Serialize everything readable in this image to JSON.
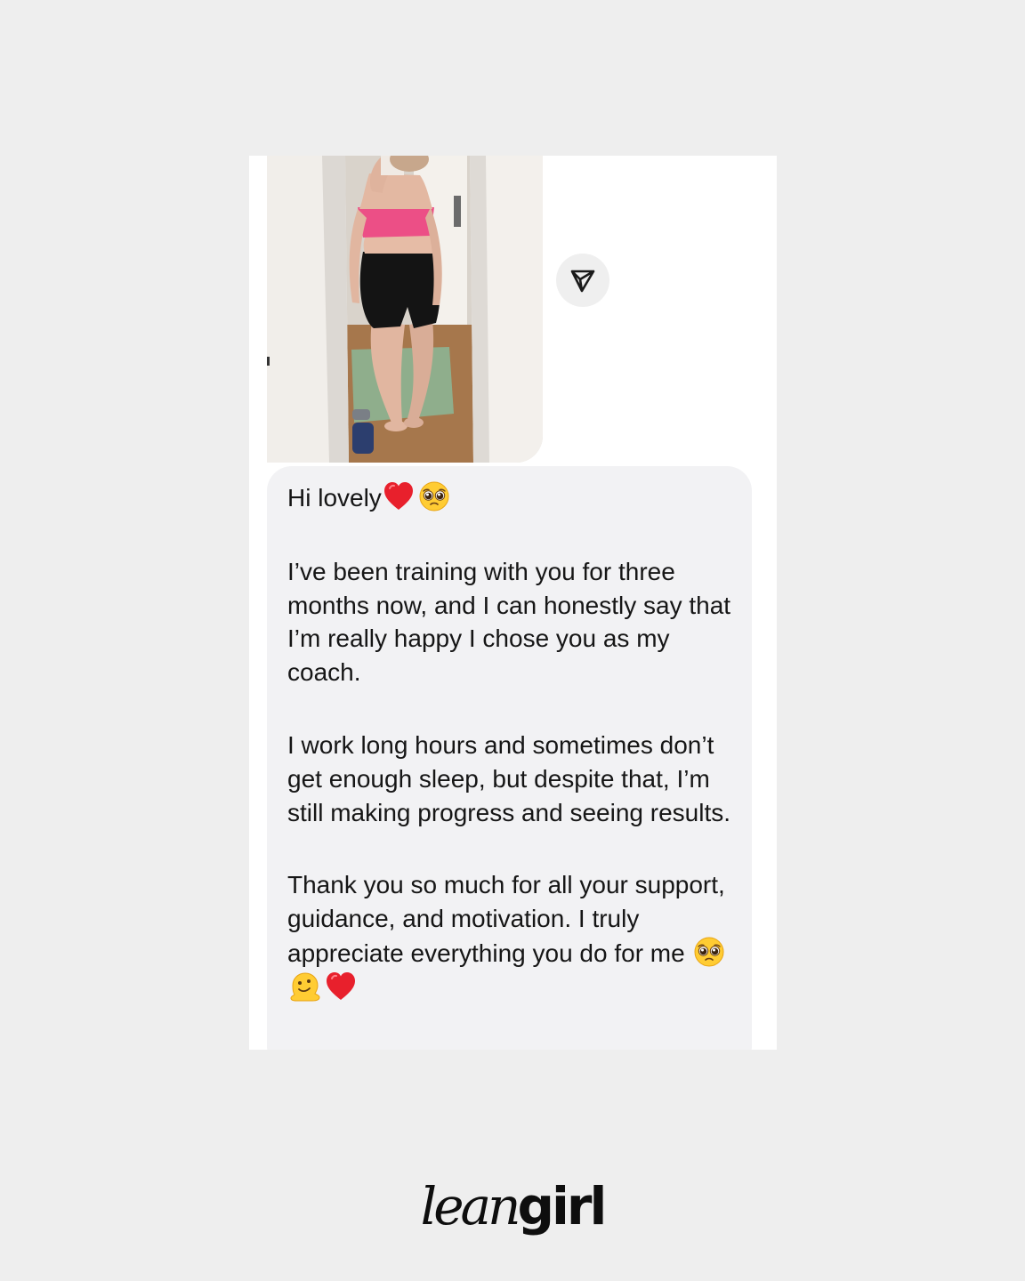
{
  "message": {
    "greeting": "Hi  lovely",
    "paragraph_1": "I’ve been training with you for three months now, and I can honestly say that I’m really happy I chose you as my coach.",
    "paragraph_2": "I work long hours and sometimes don’t get enough sleep, but despite that, I’m still making progress and seeing results.",
    "paragraph_3": "Thank you so much for all your support, guidance, and motivation. I truly appreciate everything you do for me",
    "greeting_emojis": [
      "red-heart-emoji",
      "pleading-face-emoji"
    ],
    "closing_emojis": [
      "pleading-face-emoji",
      "melting-face-emoji",
      "red-heart-emoji"
    ]
  },
  "share_button": {
    "icon": "send-icon"
  },
  "brand": {
    "part_1": "lean",
    "part_2": "girl"
  },
  "colors": {
    "page_background": "#eeeeee",
    "card_background": "#ffffff",
    "bubble_background": "#f2f2f4",
    "text": "#161616",
    "heart": "#e8202c"
  }
}
